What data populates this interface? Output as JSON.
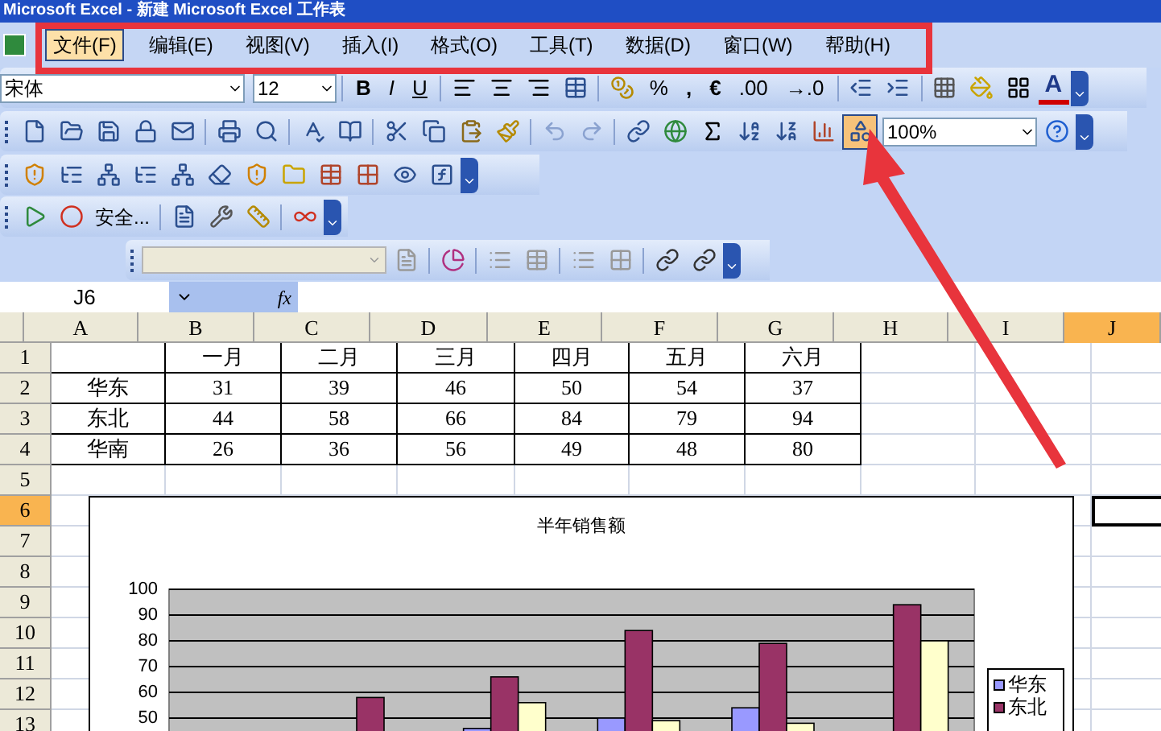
{
  "window": {
    "title": "Microsoft Excel - 新建 Microsoft Excel 工作表"
  },
  "menu": [
    {
      "label": "文件(F)",
      "selected": true
    },
    {
      "label": "编辑(E)",
      "selected": false
    },
    {
      "label": "视图(V)",
      "selected": false
    },
    {
      "label": "插入(I)",
      "selected": false
    },
    {
      "label": "格式(O)",
      "selected": false
    },
    {
      "label": "工具(T)",
      "selected": false
    },
    {
      "label": "数据(D)",
      "selected": false
    },
    {
      "label": "窗口(W)",
      "selected": false
    },
    {
      "label": "帮助(H)",
      "selected": false
    }
  ],
  "formatting_toolbar": {
    "font": "宋体",
    "size": "12",
    "bold": "B",
    "italic": "I",
    "underline": "U",
    "percent": "%",
    "comma": ",",
    "euro": "€",
    "increase_decimal": ".00",
    "decrease_decimal": "→.0",
    "font_color": "A"
  },
  "standard_toolbar": {
    "zoom": "100%",
    "drawing_pressed": true
  },
  "macro_toolbar": {
    "security": "安全..."
  },
  "formula_bar": {
    "name_box": "J6",
    "fx": "fx"
  },
  "sheet": {
    "columns": [
      {
        "label": "A",
        "selected": false
      },
      {
        "label": "B",
        "selected": false
      },
      {
        "label": "C",
        "selected": false
      },
      {
        "label": "D",
        "selected": false
      },
      {
        "label": "E",
        "selected": false
      },
      {
        "label": "F",
        "selected": false
      },
      {
        "label": "G",
        "selected": false
      },
      {
        "label": "H",
        "selected": false
      },
      {
        "label": "I",
        "selected": false
      },
      {
        "label": "J",
        "selected": true
      }
    ],
    "rows": [
      {
        "number": "1",
        "selected": false,
        "cells": [
          null,
          "一月",
          "二月",
          "三月",
          "四月",
          "五月",
          "六月"
        ]
      },
      {
        "number": "2",
        "selected": false,
        "cells": [
          "华东",
          "31",
          "39",
          "46",
          "50",
          "54",
          "37"
        ]
      },
      {
        "number": "3",
        "selected": false,
        "cells": [
          "东北",
          "44",
          "58",
          "66",
          "84",
          "79",
          "94"
        ]
      },
      {
        "number": "4",
        "selected": false,
        "cells": [
          "华南",
          "26",
          "36",
          "56",
          "49",
          "48",
          "80"
        ]
      },
      {
        "number": "5",
        "selected": false
      },
      {
        "number": "6",
        "selected": true
      },
      {
        "number": "7",
        "selected": false
      },
      {
        "number": "8",
        "selected": false
      },
      {
        "number": "9",
        "selected": false
      },
      {
        "number": "10",
        "selected": false
      },
      {
        "number": "11",
        "selected": false
      },
      {
        "number": "12",
        "selected": false
      },
      {
        "number": "13",
        "selected": false
      }
    ]
  },
  "chart": {
    "chart_data": {
      "type": "bar",
      "title": "半年销售额",
      "ylim": [
        0,
        100
      ],
      "yticks": [
        50,
        60,
        70,
        80,
        90,
        100
      ],
      "grid": true,
      "legend": "right",
      "series": [
        {
          "name": "华东",
          "color": "#9999ff",
          "values": [
            null,
            null,
            46,
            50,
            54,
            null
          ]
        },
        {
          "name": "东北",
          "color": "#993366",
          "values": [
            null,
            58,
            66,
            84,
            79,
            94
          ]
        },
        {
          "color": "#ffffcc",
          "values": [
            null,
            null,
            56,
            49,
            48,
            80
          ]
        }
      ]
    }
  }
}
